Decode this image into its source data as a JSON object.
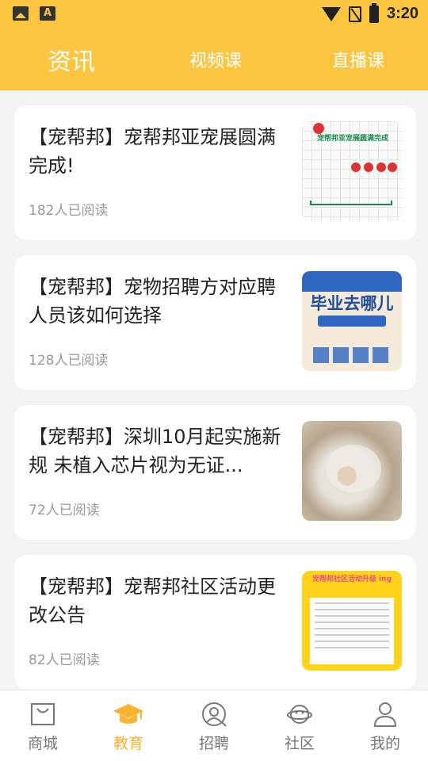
{
  "status_bar": {
    "time": "3:20",
    "app_badge_letter": "A"
  },
  "top_tabs": [
    {
      "label": "资讯",
      "active": true
    },
    {
      "label": "视频课",
      "active": false
    },
    {
      "label": "直播课",
      "active": false
    }
  ],
  "articles": [
    {
      "title": "【宠帮邦】宠帮邦亚宠展圆满完成!",
      "reads": "182人已阅读",
      "thumb_icon": "poster-pet-expo-icon"
    },
    {
      "title": "【宠帮邦】宠物招聘方对应聘人员该如何选择",
      "reads": "128人已阅读",
      "thumb_icon": "poster-graduation-recruit-icon"
    },
    {
      "title": "【宠帮邦】深圳10月起实施新规 未植入芯片视为无证...",
      "reads": "72人已阅读",
      "thumb_icon": "cat-photo"
    },
    {
      "title": "【宠帮邦】宠帮邦社区活动更改公告",
      "reads": "82人已阅读",
      "thumb_icon": "poster-community-notice-icon"
    }
  ],
  "thumbs": {
    "t1": {
      "header": "宠帮邦亚宠展圆满完成"
    },
    "t2": {
      "header": "毕业去哪儿"
    },
    "t4": {
      "header": "宠帮邦社区活动升级 ing"
    }
  },
  "bottom_tabs": [
    {
      "label": "商城",
      "icon": "bag-icon",
      "active": false
    },
    {
      "label": "教育",
      "icon": "graduation-cap-icon",
      "active": true
    },
    {
      "label": "招聘",
      "icon": "recruit-search-icon",
      "active": false
    },
    {
      "label": "社区",
      "icon": "planet-icon",
      "active": false
    },
    {
      "label": "我的",
      "icon": "user-icon",
      "active": false
    }
  ],
  "colors": {
    "accent": "#fcc540",
    "active_tab": "#fcb12f",
    "text": "#222222",
    "muted": "#999999"
  }
}
